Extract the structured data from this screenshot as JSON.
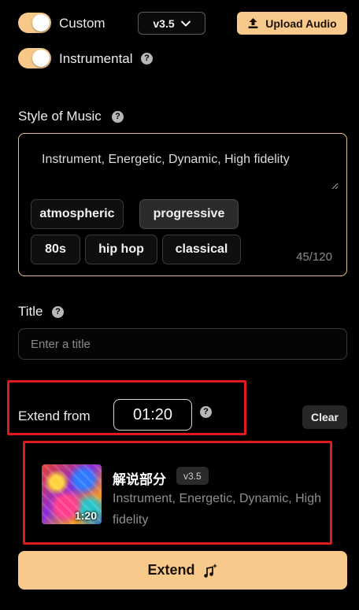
{
  "controls": {
    "custom": {
      "label": "Custom",
      "on": true
    },
    "instrumental": {
      "label": "Instrumental",
      "on": true
    },
    "version": "v3.5",
    "upload_label": "Upload Audio"
  },
  "style": {
    "label": "Style of Music",
    "value": "Instrument, Energetic, Dynamic, High fidelity",
    "tags": [
      {
        "label": "atmospheric",
        "active": false
      },
      {
        "label": "progressive",
        "active": true
      },
      {
        "label": "80s",
        "active": false
      },
      {
        "label": "hip hop",
        "active": false
      },
      {
        "label": "classical",
        "active": false
      }
    ],
    "char_count": "45/120"
  },
  "title": {
    "label": "Title",
    "placeholder": "Enter a title"
  },
  "extend": {
    "label": "Extend from",
    "time": "01:20",
    "clear_label": "Clear",
    "button_label": "Extend"
  },
  "song": {
    "title": "解说部分",
    "version": "v3.5",
    "description": "Instrument, Energetic, Dynamic, High fidelity",
    "duration": "1:20"
  },
  "colors": {
    "accent": "#f7ca8b",
    "highlight": "#e0191d",
    "background": "#000000"
  }
}
